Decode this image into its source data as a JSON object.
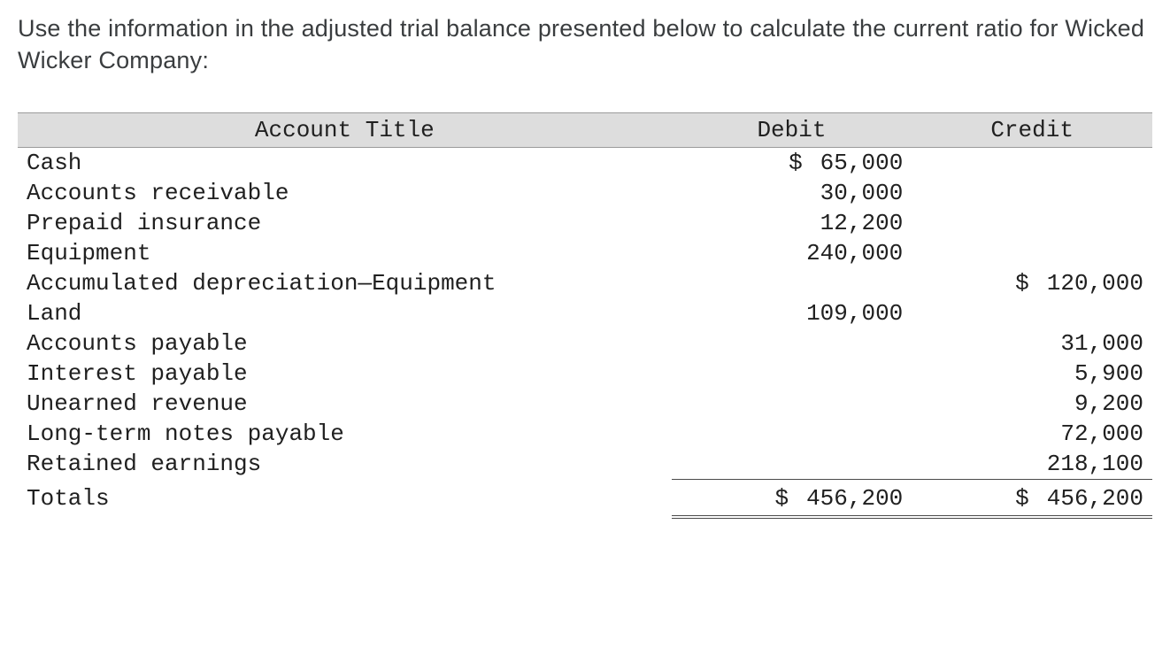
{
  "prompt": "Use the information in the adjusted trial balance presented below to calculate the current ratio for Wicked Wicker Company:",
  "headers": {
    "title": "Account Title",
    "debit": "Debit",
    "credit": "Credit"
  },
  "rows": [
    {
      "title": "Cash",
      "debit_sym": "$",
      "debit": "65,000",
      "credit_sym": "",
      "credit": ""
    },
    {
      "title": "Accounts receivable",
      "debit_sym": "",
      "debit": "30,000",
      "credit_sym": "",
      "credit": ""
    },
    {
      "title": "Prepaid insurance",
      "debit_sym": "",
      "debit": "12,200",
      "credit_sym": "",
      "credit": ""
    },
    {
      "title": "Equipment",
      "debit_sym": "",
      "debit": "240,000",
      "credit_sym": "",
      "credit": ""
    },
    {
      "title": "Accumulated depreciation—Equipment",
      "debit_sym": "",
      "debit": "",
      "credit_sym": "$",
      "credit": "120,000"
    },
    {
      "title": "Land",
      "debit_sym": "",
      "debit": "109,000",
      "credit_sym": "",
      "credit": ""
    },
    {
      "title": "Accounts payable",
      "debit_sym": "",
      "debit": "",
      "credit_sym": "",
      "credit": "31,000"
    },
    {
      "title": "Interest payable",
      "debit_sym": "",
      "debit": "",
      "credit_sym": "",
      "credit": "5,900"
    },
    {
      "title": "Unearned revenue",
      "debit_sym": "",
      "debit": "",
      "credit_sym": "",
      "credit": "9,200"
    },
    {
      "title": "Long-term notes payable",
      "debit_sym": "",
      "debit": "",
      "credit_sym": "",
      "credit": "72,000"
    },
    {
      "title": "Retained earnings",
      "debit_sym": "",
      "debit": "",
      "credit_sym": "",
      "credit": "218,100"
    }
  ],
  "totals": {
    "title": "Totals",
    "debit_sym": "$",
    "debit": "456,200",
    "credit_sym": "$",
    "credit": "456,200"
  }
}
